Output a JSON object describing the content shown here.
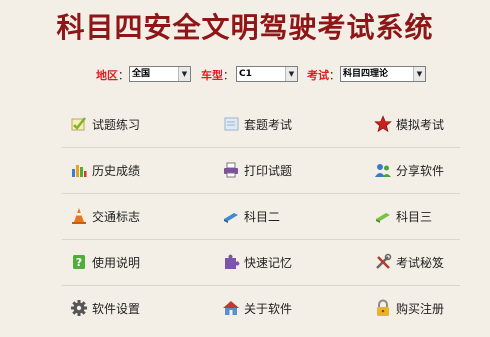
{
  "app": {
    "title": "科目四安全文明驾驶考试系统"
  },
  "filters": {
    "region": {
      "label": "地区",
      "value": "全国"
    },
    "vehicle": {
      "label": "车型",
      "value": "C1"
    },
    "exam": {
      "label": "考试",
      "value": "科目四理论"
    }
  },
  "menu": [
    {
      "label": "试题练习",
      "icon": "check-pencil-icon"
    },
    {
      "label": "套题考试",
      "icon": "paper-icon"
    },
    {
      "label": "模拟考试",
      "icon": "star-icon"
    },
    {
      "label": "历史成绩",
      "icon": "bar-chart-icon"
    },
    {
      "label": "打印试题",
      "icon": "printer-icon"
    },
    {
      "label": "分享软件",
      "icon": "users-icon"
    },
    {
      "label": "交通标志",
      "icon": "traffic-cone-icon"
    },
    {
      "label": "科目二",
      "icon": "blue-eraser-icon"
    },
    {
      "label": "科目三",
      "icon": "green-eraser-icon"
    },
    {
      "label": "使用说明",
      "icon": "help-book-icon"
    },
    {
      "label": "快速记忆",
      "icon": "puzzle-icon"
    },
    {
      "label": "考试秘笈",
      "icon": "tools-icon"
    },
    {
      "label": "软件设置",
      "icon": "gear-icon"
    },
    {
      "label": "关于软件",
      "icon": "home-icon"
    },
    {
      "label": "购买注册",
      "icon": "lock-icon"
    }
  ],
  "colors": {
    "title": "#8e1616",
    "filter_label": "#e01d1d",
    "background": "#f3efe6"
  }
}
